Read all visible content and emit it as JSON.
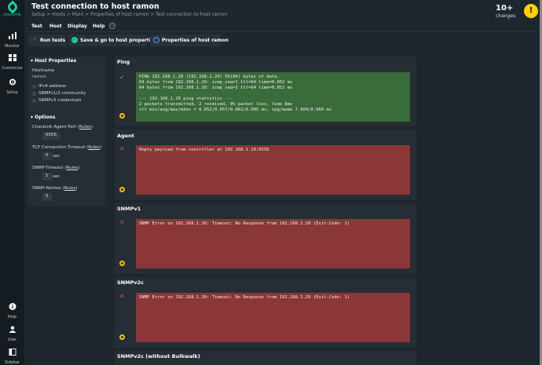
{
  "sidebar": {
    "logo_text": "checkmk",
    "items": [
      {
        "label": "Monitor",
        "icon": "bar-chart-icon"
      },
      {
        "label": "Customize",
        "icon": "grid-icon"
      },
      {
        "label": "Setup",
        "icon": "gear-icon"
      }
    ],
    "bottom_items": [
      {
        "label": "Help",
        "icon": "info-icon"
      },
      {
        "label": "User",
        "icon": "user-icon"
      },
      {
        "label": "Sidebar",
        "icon": "sidebar-icon"
      }
    ]
  },
  "header": {
    "title": "Test connection to host ramon",
    "breadcrumb": "Setup > Hosts > Main > Properties of host ramon > Test connection to host ramon",
    "changes_count": "10+",
    "changes_label": "changes",
    "warn_icon": "!"
  },
  "menu": {
    "items": [
      "Test",
      "Host",
      "Display",
      "Help"
    ],
    "toggle_glyph": "−"
  },
  "actions": {
    "run_tests": "Run tests",
    "save_goto": "Save & go to host properties",
    "properties": "Properties of host ramon"
  },
  "host_properties": {
    "section_title": "Host Properties",
    "hostname_label": "Hostname",
    "hostname_value": "ramon",
    "checkboxes": [
      "IPv4 address",
      "SNMPv1/2 community",
      "SNMPv3 credentials"
    ]
  },
  "options": {
    "section_title": "Options",
    "agent_port_label": "Checkmk Agent Port (",
    "agent_port_link": "Rules",
    "agent_port_value": "6556",
    "tcp_timeout_label": "TCP Connection Timeout (",
    "tcp_timeout_link": "Rules",
    "tcp_timeout_value": "5",
    "tcp_timeout_unit": "sec",
    "snmp_timeout_label": "SNMP-Timeout (",
    "snmp_timeout_link": "Rules",
    "snmp_timeout_value": "1",
    "snmp_timeout_unit": "sec",
    "snmp_retries_label": "SNMP-Retries (",
    "snmp_retries_link": "Rules",
    "snmp_retries_value": "5",
    "closing_paren": ")"
  },
  "tests": {
    "ping": {
      "title": "Ping",
      "status_glyph": "✓",
      "output": "PING 192.168.1.20 (192.168.1.20) 56(84) bytes of data.\n64 bytes from 192.168.1.20: icmp_seq=1 ttl=64 time=0.062 ms\n64 bytes from 192.168.1.20: icmp_seq=2 ttl=64 time=0.052 ms\n\n--- 192.168.1.20 ping statistics ---\n2 packets transmitted, 2 received, 0% packet loss, time 8ms\nrtt min/avg/max/mdev = 0.052/0.057/0.062/0.005 ms, ipg/ewma 7.904/0.060 ms"
    },
    "agent": {
      "title": "Agent",
      "status_glyph": "✕",
      "output": "Empty payload from controller at 192.168.1.20:6556"
    },
    "snmpv1": {
      "title": "SNMPv1",
      "status_glyph": "✕",
      "output": "SNMP Error on 192.168.1.20: Timeout: No Response from 192.168.1.20 (Exit-Code: 1)"
    },
    "snmpv2c": {
      "title": "SNMPv2c",
      "status_glyph": "✕",
      "output": "SNMP Error on 192.168.1.20: Timeout: No Response from 192.168.1.20 (Exit-Code: 1)"
    },
    "snmpv2c_nobulk": {
      "title": "SNMPv2c (without Bulkwalk)"
    }
  },
  "colors": {
    "ok_bg": "#3a6b3a",
    "err_bg": "#8b3637",
    "accent": "#15d1a0",
    "warn": "#ffd000"
  }
}
